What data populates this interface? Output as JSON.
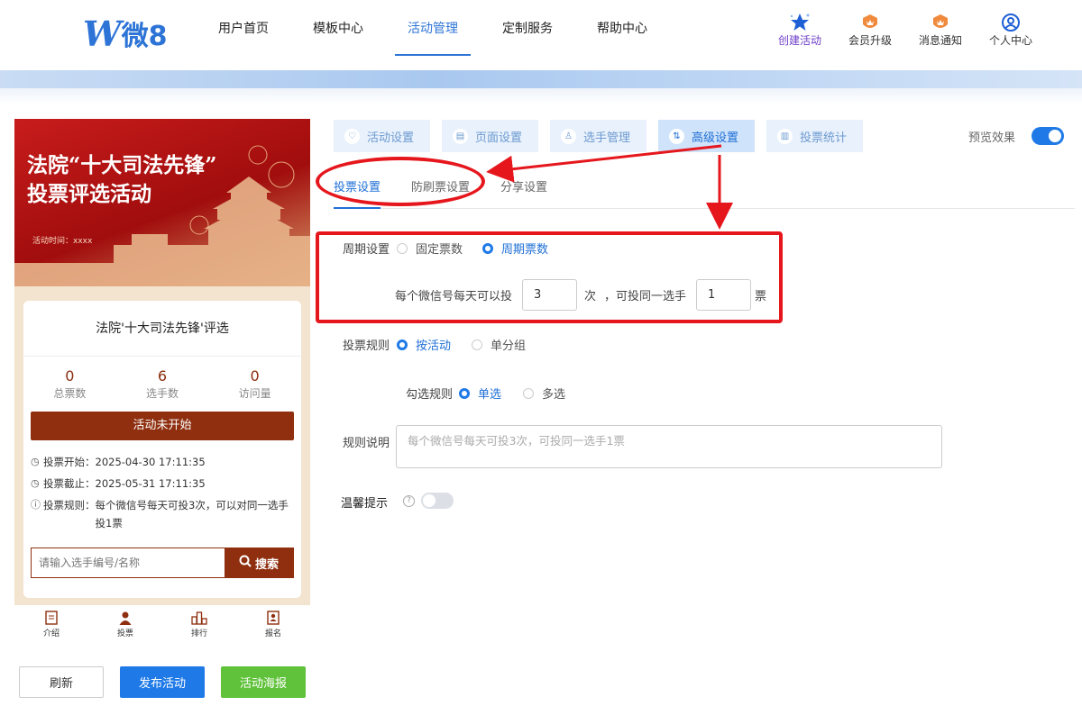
{
  "logo": {
    "mark": "W",
    "text": "微8"
  },
  "nav": {
    "items": [
      "用户首页",
      "模板中心",
      "活动管理",
      "定制服务",
      "帮助中心"
    ],
    "active": "活动管理"
  },
  "top_actions": [
    "创建活动",
    "会员升级",
    "消息通知",
    "个人中心"
  ],
  "phone": {
    "banner_title_line1": "法院“十大司法先锋”",
    "banner_title_line2": "投票评选活动",
    "banner_time": "活动时间：xxxx",
    "card_title": "法院'十大司法先锋'评选",
    "stats": [
      {
        "value": "0",
        "label": "总票数"
      },
      {
        "value": "6",
        "label": "选手数"
      },
      {
        "value": "0",
        "label": "访问量"
      }
    ],
    "status_button": "活动未开始",
    "vote_start_key": "投票开始：",
    "vote_start": "2025-04-30 17:11:35",
    "vote_end_key": "投票截止：",
    "vote_end": "2025-05-31 17:11:35",
    "vote_rule_key": "投票规则：",
    "vote_rule": "每个微信号每天可投3次，可以对同一选手投1票",
    "search_placeholder": "请输入选手编号/名称",
    "search_button": "搜索",
    "tabs": [
      "介绍",
      "投票",
      "排行",
      "报名"
    ]
  },
  "bottom_actions": {
    "refresh": "刷新",
    "publish": "发布活动",
    "poster": "活动海报"
  },
  "steps": [
    "活动设置",
    "页面设置",
    "选手管理",
    "高级设置",
    "投票统计"
  ],
  "active_step": "高级设置",
  "preview_label": "预览效果",
  "subtabs": [
    "投票设置",
    "防刷票设置",
    "分享设置"
  ],
  "form": {
    "period_label": "周期设置",
    "period_opt1": "固定票数",
    "period_opt2": "周期票数",
    "per_day_text": "每个微信号每天可以投",
    "per_day_value": "3",
    "times_unit": "次",
    "same_player_text": "，可投同一选手",
    "same_player_value": "1",
    "votes_unit": "票",
    "rule_label": "投票规则",
    "rule_opt1": "按活动",
    "rule_opt2": "单分组",
    "select_label": "勾选规则",
    "select_opt1": "单选",
    "select_opt2": "多选",
    "desc_label": "规则说明",
    "desc_value": "每个微信号每天可投3次，可投同一选手1票",
    "tip_label": "温馨提示"
  }
}
